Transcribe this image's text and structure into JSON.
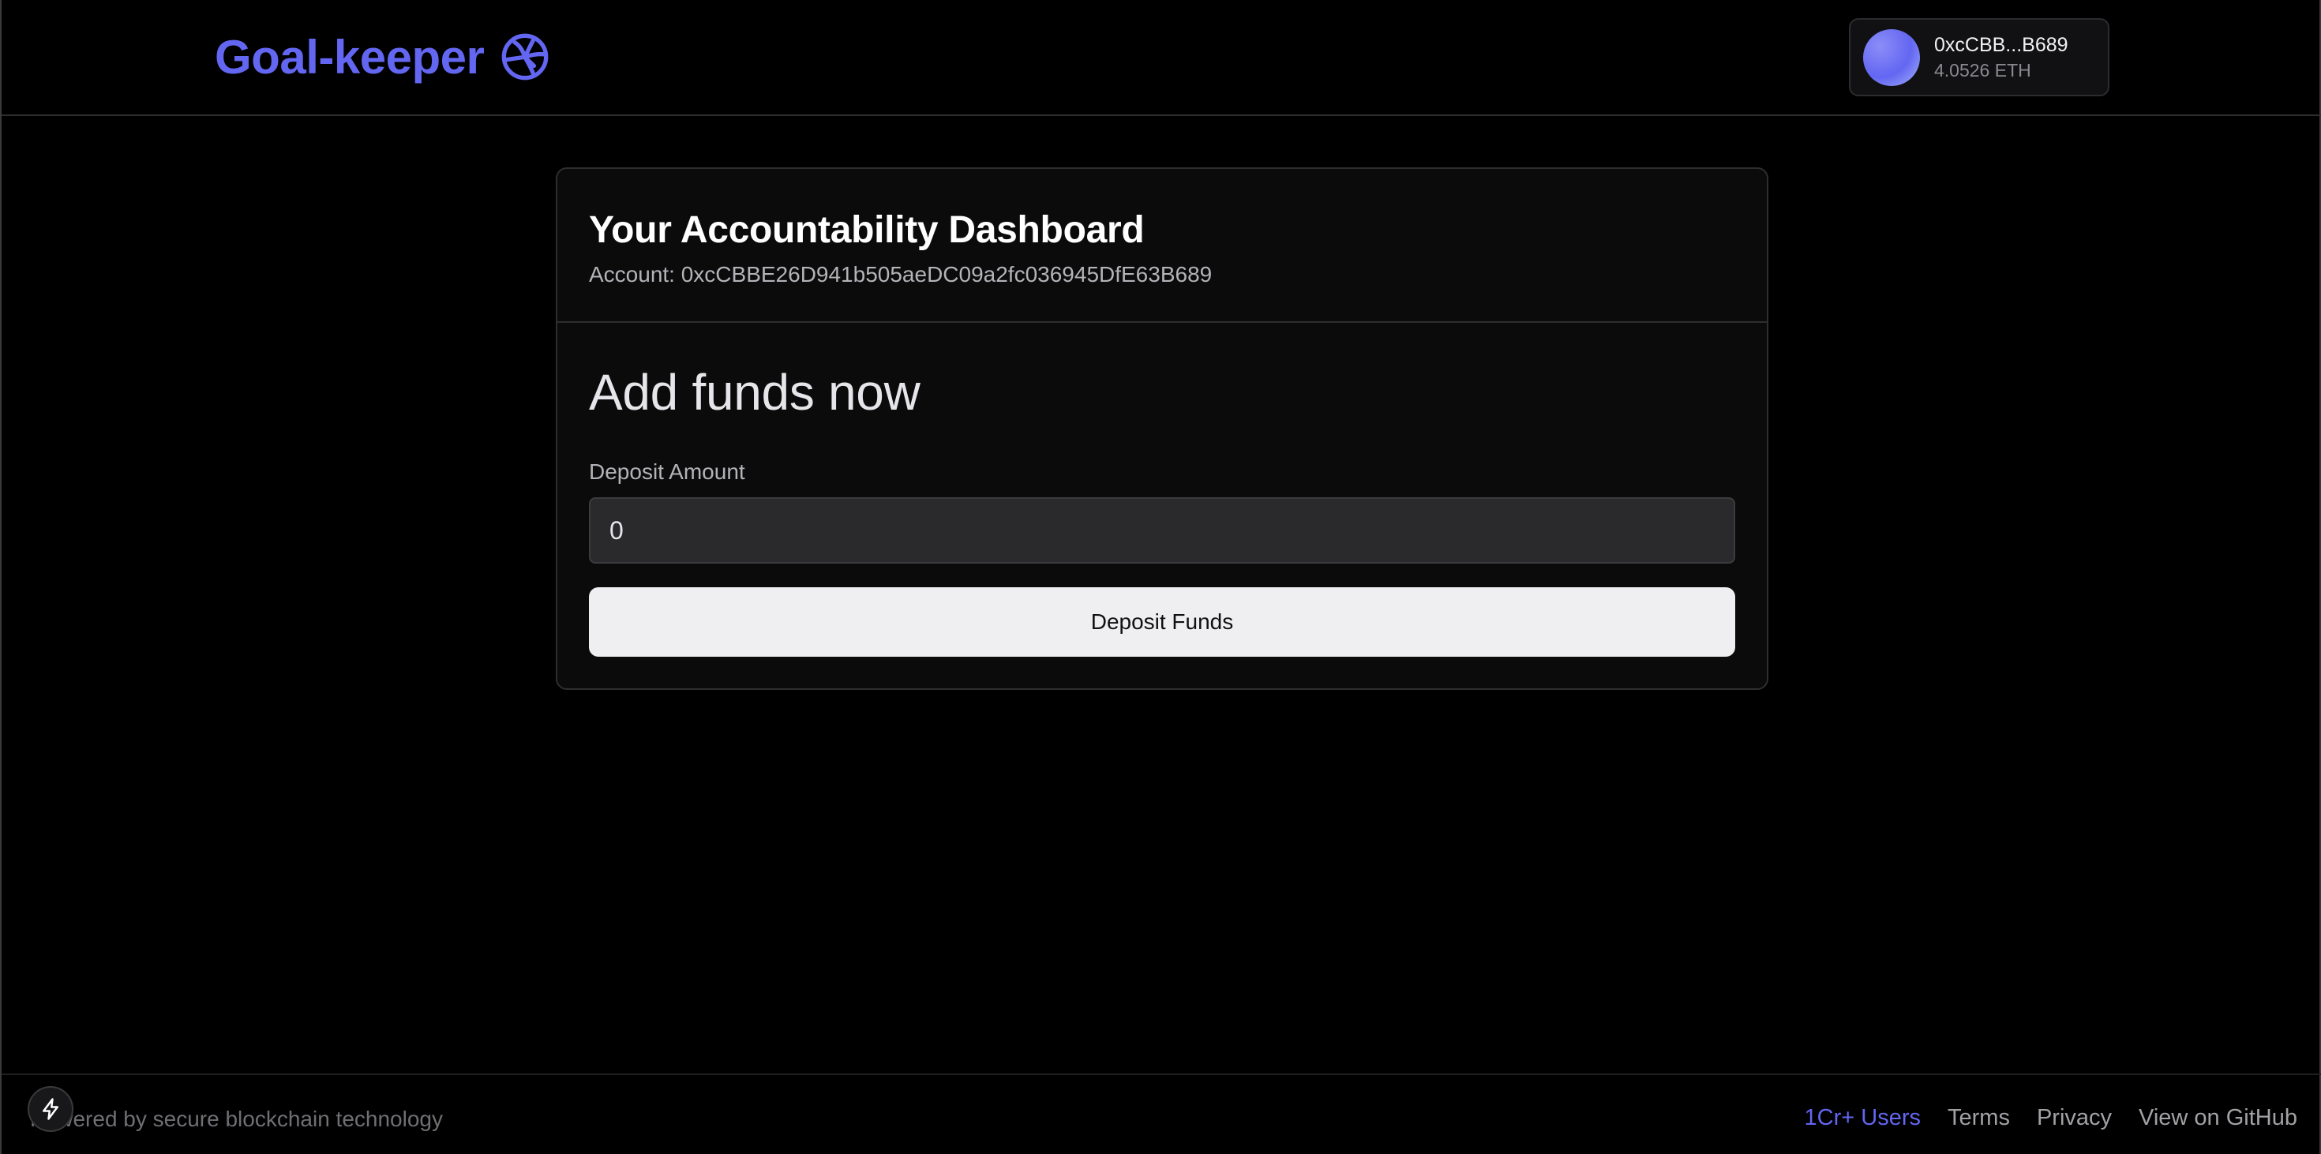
{
  "header": {
    "brand_title": "Goal-keeper",
    "brand_icon": "volleyball-icon",
    "wallet": {
      "address": "0xcCBB...B689",
      "balance": "4.0526 ETH"
    }
  },
  "card": {
    "title": "Your Accountability Dashboard",
    "account_line": "Account: 0xcCBBE26D941b505aeDC09a2fc036945DfE63B689",
    "section_title": "Add funds now",
    "deposit_label": "Deposit Amount",
    "deposit_value": "0",
    "deposit_button": "Deposit Funds"
  },
  "footer": {
    "tagline": "Powered by secure blockchain technology",
    "links": {
      "users": "1Cr+ Users",
      "terms": "Terms",
      "privacy": "Privacy",
      "github": "View on GitHub"
    }
  },
  "colors": {
    "accent": "#6366f1",
    "background": "#000000",
    "card": "#0b0b0c",
    "button": "#efeff1"
  }
}
